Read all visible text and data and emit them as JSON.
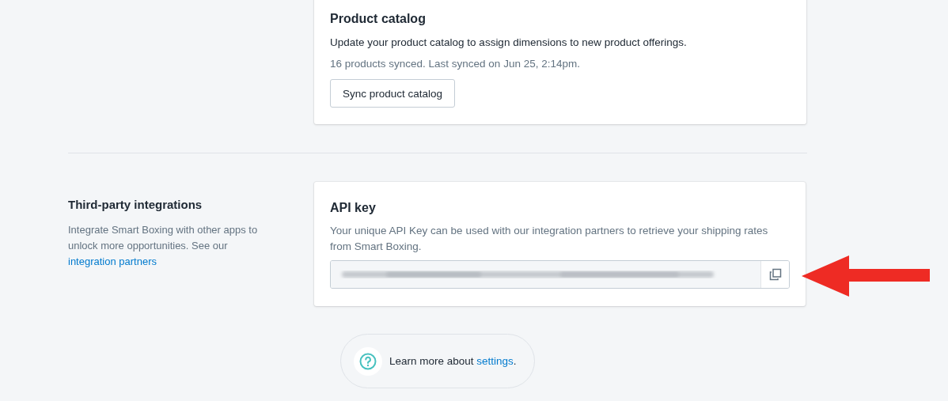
{
  "catalog_card": {
    "title": "Product catalog",
    "description": "Update your product catalog to assign dimensions to new product offerings.",
    "sync_status": "16 products synced. Last synced on Jun 25, 2:14pm.",
    "button": "Sync product catalog"
  },
  "integrations_section": {
    "title": "Third-party integrations",
    "description": "Integrate Smart Boxing with other apps to unlock more opportunities. See our",
    "link": "integration partners"
  },
  "api_card": {
    "title": "API key",
    "description": "Your unique API Key can be used with our integration partners to retrieve your shipping rates from Smart Boxing."
  },
  "help": {
    "text": "Learn more about",
    "link": "settings",
    "suffix": "."
  }
}
